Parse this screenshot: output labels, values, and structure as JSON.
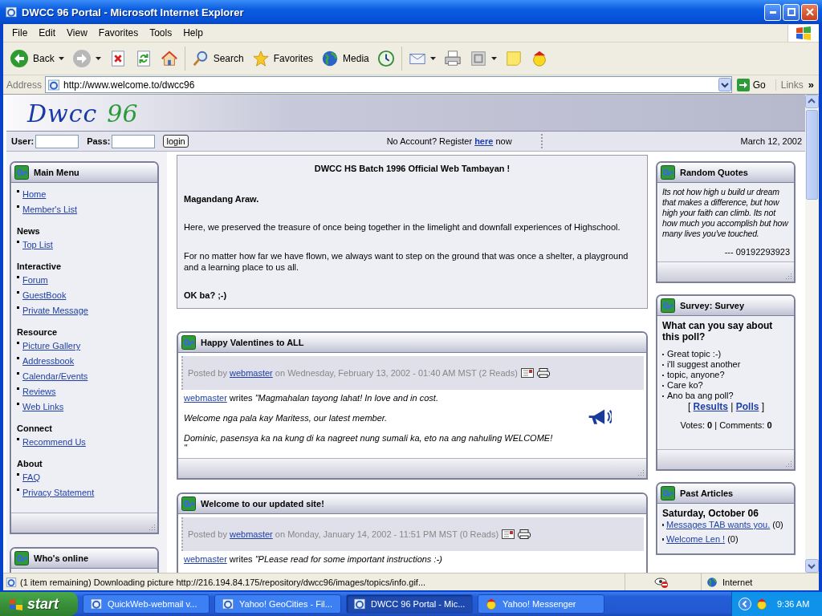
{
  "window": {
    "title": "DWCC 96 Portal - Microsoft Internet Explorer"
  },
  "menu": [
    "File",
    "Edit",
    "View",
    "Favorites",
    "Tools",
    "Help"
  ],
  "toolbar": [
    {
      "kind": "back",
      "label": "Back",
      "dropdown": true
    },
    {
      "kind": "forward",
      "dropdown": true
    },
    {
      "kind": "stop"
    },
    {
      "kind": "refresh"
    },
    {
      "kind": "home"
    },
    {
      "kind": "separator"
    },
    {
      "kind": "search",
      "label": "Search"
    },
    {
      "kind": "favorites",
      "label": "Favorites"
    },
    {
      "kind": "media",
      "label": "Media"
    },
    {
      "kind": "history"
    },
    {
      "kind": "separator"
    },
    {
      "kind": "mail",
      "dropdown": true
    },
    {
      "kind": "print"
    },
    {
      "kind": "edit",
      "dropdown": true
    },
    {
      "kind": "note"
    },
    {
      "kind": "messenger"
    }
  ],
  "address": {
    "label": "Address",
    "value": "http://www.welcome.to/dwcc96",
    "go": "Go",
    "links": "Links",
    "more": "»"
  },
  "site": {
    "logo": "Dwcc",
    "logo_number": "96"
  },
  "login": {
    "user_label": "User:",
    "pass_label": "Pass:",
    "button": "login",
    "register_before": "No Account? Register",
    "register_link": "here",
    "register_after": "now",
    "date": "March 12, 2002"
  },
  "main_menu": {
    "title": "Main Menu",
    "sections": [
      {
        "items": [
          "Home",
          "Member's List"
        ]
      },
      {
        "heading": "News",
        "items": [
          "Top List"
        ]
      },
      {
        "heading": "Interactive",
        "items": [
          "Forum",
          "GuestBook",
          "Private Message"
        ]
      },
      {
        "heading": "Resource",
        "items": [
          "Picture Gallery",
          "Addressbook",
          "Calendar/Events",
          "Reviews",
          "Web Links"
        ]
      },
      {
        "heading": "Connect",
        "items": [
          "Recommend Us"
        ]
      },
      {
        "heading": "About",
        "items": [
          "FAQ",
          "Privacy Statement"
        ]
      }
    ]
  },
  "who_online": {
    "title": "Who's online"
  },
  "welcome": {
    "title": "DWCC HS Batch 1996 Official Web Tambayan !",
    "greeting": "Magandang Araw.",
    "paragraphs": [
      "Here, we preserved the treasure of once being together in the limelight and downfall experiences of Highschool.",
      "For no matter how far we have flown, we always want to step on the ground that was once a shelter, a playground and a learning place to us all."
    ],
    "closing": "OK ba? ;-)"
  },
  "articles": [
    {
      "title": "Happy Valentines to ALL",
      "posted_by": "Posted by",
      "author": "webmaster",
      "meta": "on Wednesday, February 13, 2002 - 01:40 AM MST (2 Reads)",
      "writer": "webmaster",
      "writes": "writes",
      "lead": "\"Magmahalan tayong lahat! In love and in cost.",
      "lines": [
        "Welcome nga pala kay Maritess, our latest member.",
        "Dominic, pasensya ka na kung di ka nagreet nung sumali ka, eto na ang nahuling WELCOME!"
      ],
      "end": "\"",
      "kind": "announcement"
    },
    {
      "title": "Welcome to our updated site!",
      "posted_by": "Posted by",
      "author": "webmaster",
      "meta": "on Monday, January 14, 2002 - 11:51 PM MST (0 Reads)",
      "writer": "webmaster",
      "writes": "writes",
      "lead": "\"PLease read for some important instructions :-)",
      "kind": "plain"
    }
  ],
  "quotes": {
    "title": "Random Quotes",
    "text": "Its not how high u build ur dream that makes a difference, but how high your faith can climb. Its not how much you accomplish but how many lives you've touched.",
    "source": "--- 09192293923"
  },
  "survey": {
    "title": "Survey: Survey",
    "question": "What can you say about this poll?",
    "options": [
      "Great topic :-)",
      "i'll suggest another",
      "topic, anyone?",
      "Care ko?",
      "Ano ba ang poll?"
    ],
    "open": "[",
    "results": "Results",
    "separator": "|",
    "polls": "Polls",
    "close": "]",
    "stats": "Votes: **0** | Comments: **0**"
  },
  "past_articles": {
    "title": "Past Articles",
    "date": "Saturday, October 06",
    "items": [
      {
        "title": "Messages TAB wants you.",
        "count": "(0)"
      },
      {
        "title": "Welcome Len !",
        "count": "(0)"
      }
    ]
  },
  "status_bar": {
    "text": "(1 item remaining) Downloading picture http://216.194.84.175/repository/dwcc96/images/topics/info.gif...",
    "zone": "Internet"
  },
  "taskbar": {
    "start": "start",
    "tasks": [
      {
        "label": "QuickWeb-webmail v...",
        "kind": "browser",
        "selected": false
      },
      {
        "label": "Yahoo! GeoCities - Fil...",
        "kind": "browser",
        "selected": false
      },
      {
        "label": "DWCC 96 Portal - Mic...",
        "kind": "browser",
        "selected": true
      },
      {
        "label": "Yahoo! Messenger",
        "kind": "messenger",
        "selected": false
      }
    ],
    "clock": "9:36 AM"
  }
}
